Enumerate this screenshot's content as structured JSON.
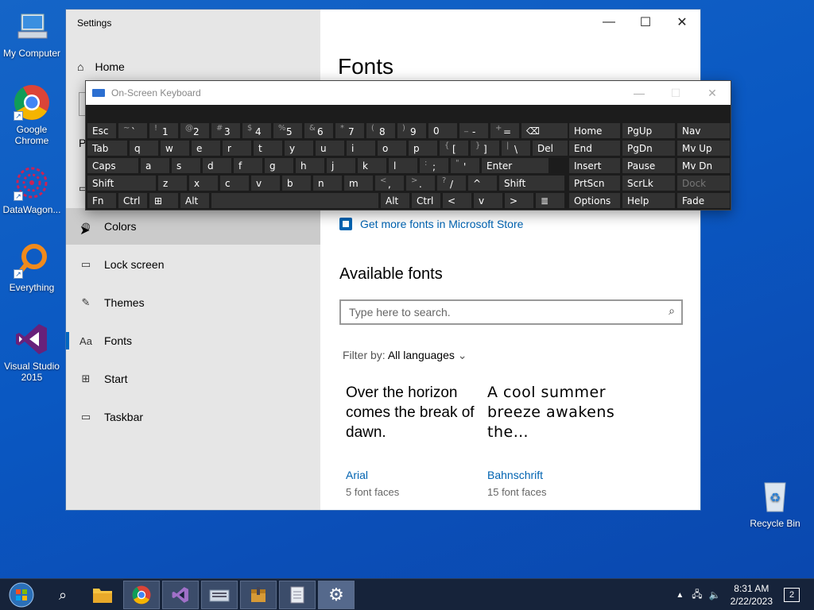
{
  "desktop": {
    "icons": [
      {
        "label": "My Computer",
        "icon": "computer-icon"
      },
      {
        "label": "Google Chrome",
        "icon": "chrome-icon"
      },
      {
        "label": "DataWagon...",
        "icon": "datawagon-icon"
      },
      {
        "label": "Everything",
        "icon": "everything-search-icon"
      },
      {
        "label": "Visual Studio 2015",
        "icon": "visual-studio-icon"
      },
      {
        "label": "Recycle Bin",
        "icon": "recycle-bin-icon"
      }
    ]
  },
  "settings": {
    "window_title": "Settings",
    "home_label": "Home",
    "nav": [
      {
        "label": "Colors",
        "icon": "palette-icon",
        "state": "hover"
      },
      {
        "label": "Lock screen",
        "icon": "lock-screen-icon"
      },
      {
        "label": "Themes",
        "icon": "themes-icon"
      },
      {
        "label": "Fonts",
        "icon": "fonts-icon",
        "state": "selected"
      },
      {
        "label": "Start",
        "icon": "start-icon"
      },
      {
        "label": "Taskbar",
        "icon": "taskbar-icon"
      }
    ],
    "partial_label": "P",
    "page_title": "Fonts",
    "store_link": "Get more fonts in Microsoft Store",
    "available_heading": "Available fonts",
    "search_placeholder": "Type here to search.",
    "filter_label": "Filter by:",
    "filter_value": "All languages",
    "fonts": [
      {
        "sample": "Over the horizon comes the break of dawn.",
        "name": "Arial",
        "faces": "5 font faces"
      },
      {
        "sample": "A cool summer breeze awakens the…",
        "name": "Bahnschrift",
        "faces": "15 font faces"
      }
    ]
  },
  "osk": {
    "title": "On-Screen Keyboard",
    "rows": [
      [
        [
          "Esc",
          ""
        ],
        [
          "`",
          "~"
        ],
        [
          "1",
          "!"
        ],
        [
          "2",
          "@"
        ],
        [
          "3",
          "#"
        ],
        [
          "4",
          "$"
        ],
        [
          "5",
          "%"
        ],
        [
          "6",
          "&"
        ],
        [
          "7",
          "*"
        ],
        [
          "8",
          "("
        ],
        [
          "9",
          ")"
        ],
        [
          "0",
          ""
        ],
        [
          "-",
          "_"
        ],
        [
          "=",
          "+"
        ],
        [
          "⌫",
          ""
        ]
      ],
      [
        [
          "Tab",
          ""
        ],
        [
          "q",
          ""
        ],
        [
          "w",
          ""
        ],
        [
          "e",
          ""
        ],
        [
          "r",
          ""
        ],
        [
          "t",
          ""
        ],
        [
          "y",
          ""
        ],
        [
          "u",
          ""
        ],
        [
          "i",
          ""
        ],
        [
          "o",
          ""
        ],
        [
          "p",
          ""
        ],
        [
          "[",
          "{"
        ],
        [
          "]",
          "}"
        ],
        [
          "\\",
          "|"
        ],
        [
          "Del",
          ""
        ]
      ],
      [
        [
          "Caps",
          ""
        ],
        [
          "a",
          ""
        ],
        [
          "s",
          ""
        ],
        [
          "d",
          ""
        ],
        [
          "f",
          ""
        ],
        [
          "g",
          ""
        ],
        [
          "h",
          ""
        ],
        [
          "j",
          ""
        ],
        [
          "k",
          ""
        ],
        [
          "l",
          ""
        ],
        [
          ";",
          ":"
        ],
        [
          "'",
          "\""
        ],
        [
          "Enter",
          ""
        ]
      ],
      [
        [
          "Shift",
          ""
        ],
        [
          "z",
          ""
        ],
        [
          "x",
          ""
        ],
        [
          "c",
          ""
        ],
        [
          "v",
          ""
        ],
        [
          "b",
          ""
        ],
        [
          "n",
          ""
        ],
        [
          "m",
          ""
        ],
        [
          ",",
          "<"
        ],
        [
          ".",
          ">"
        ],
        [
          "/",
          "?"
        ],
        [
          "^",
          ""
        ],
        [
          "Shift",
          ""
        ]
      ],
      [
        [
          "Fn",
          ""
        ],
        [
          "Ctrl",
          ""
        ],
        [
          "⊞",
          ""
        ],
        [
          "Alt",
          ""
        ],
        [
          "",
          ""
        ],
        [
          "Alt",
          ""
        ],
        [
          "Ctrl",
          ""
        ],
        [
          "<",
          ""
        ],
        [
          "v",
          ""
        ],
        [
          ">",
          ""
        ],
        [
          "≣",
          ""
        ]
      ]
    ],
    "nav_keys": [
      [
        "Home",
        "PgUp",
        "Nav"
      ],
      [
        "End",
        "PgDn",
        "Mv Up"
      ],
      [
        "Insert",
        "Pause",
        "Mv Dn"
      ],
      [
        "PrtScn",
        "ScrLk",
        "Dock"
      ],
      [
        "Options",
        "Help",
        "Fade"
      ]
    ]
  },
  "taskbar": {
    "time": "8:31 AM",
    "date": "2/22/2023",
    "notification_count": "2",
    "apps": [
      "start-orb-icon",
      "search-icon",
      "file-explorer-icon",
      "chrome-icon",
      "visual-studio-icon",
      "on-screen-keyboard-icon",
      "archive-icon",
      "notepad-icon",
      "settings-gear-icon"
    ]
  }
}
